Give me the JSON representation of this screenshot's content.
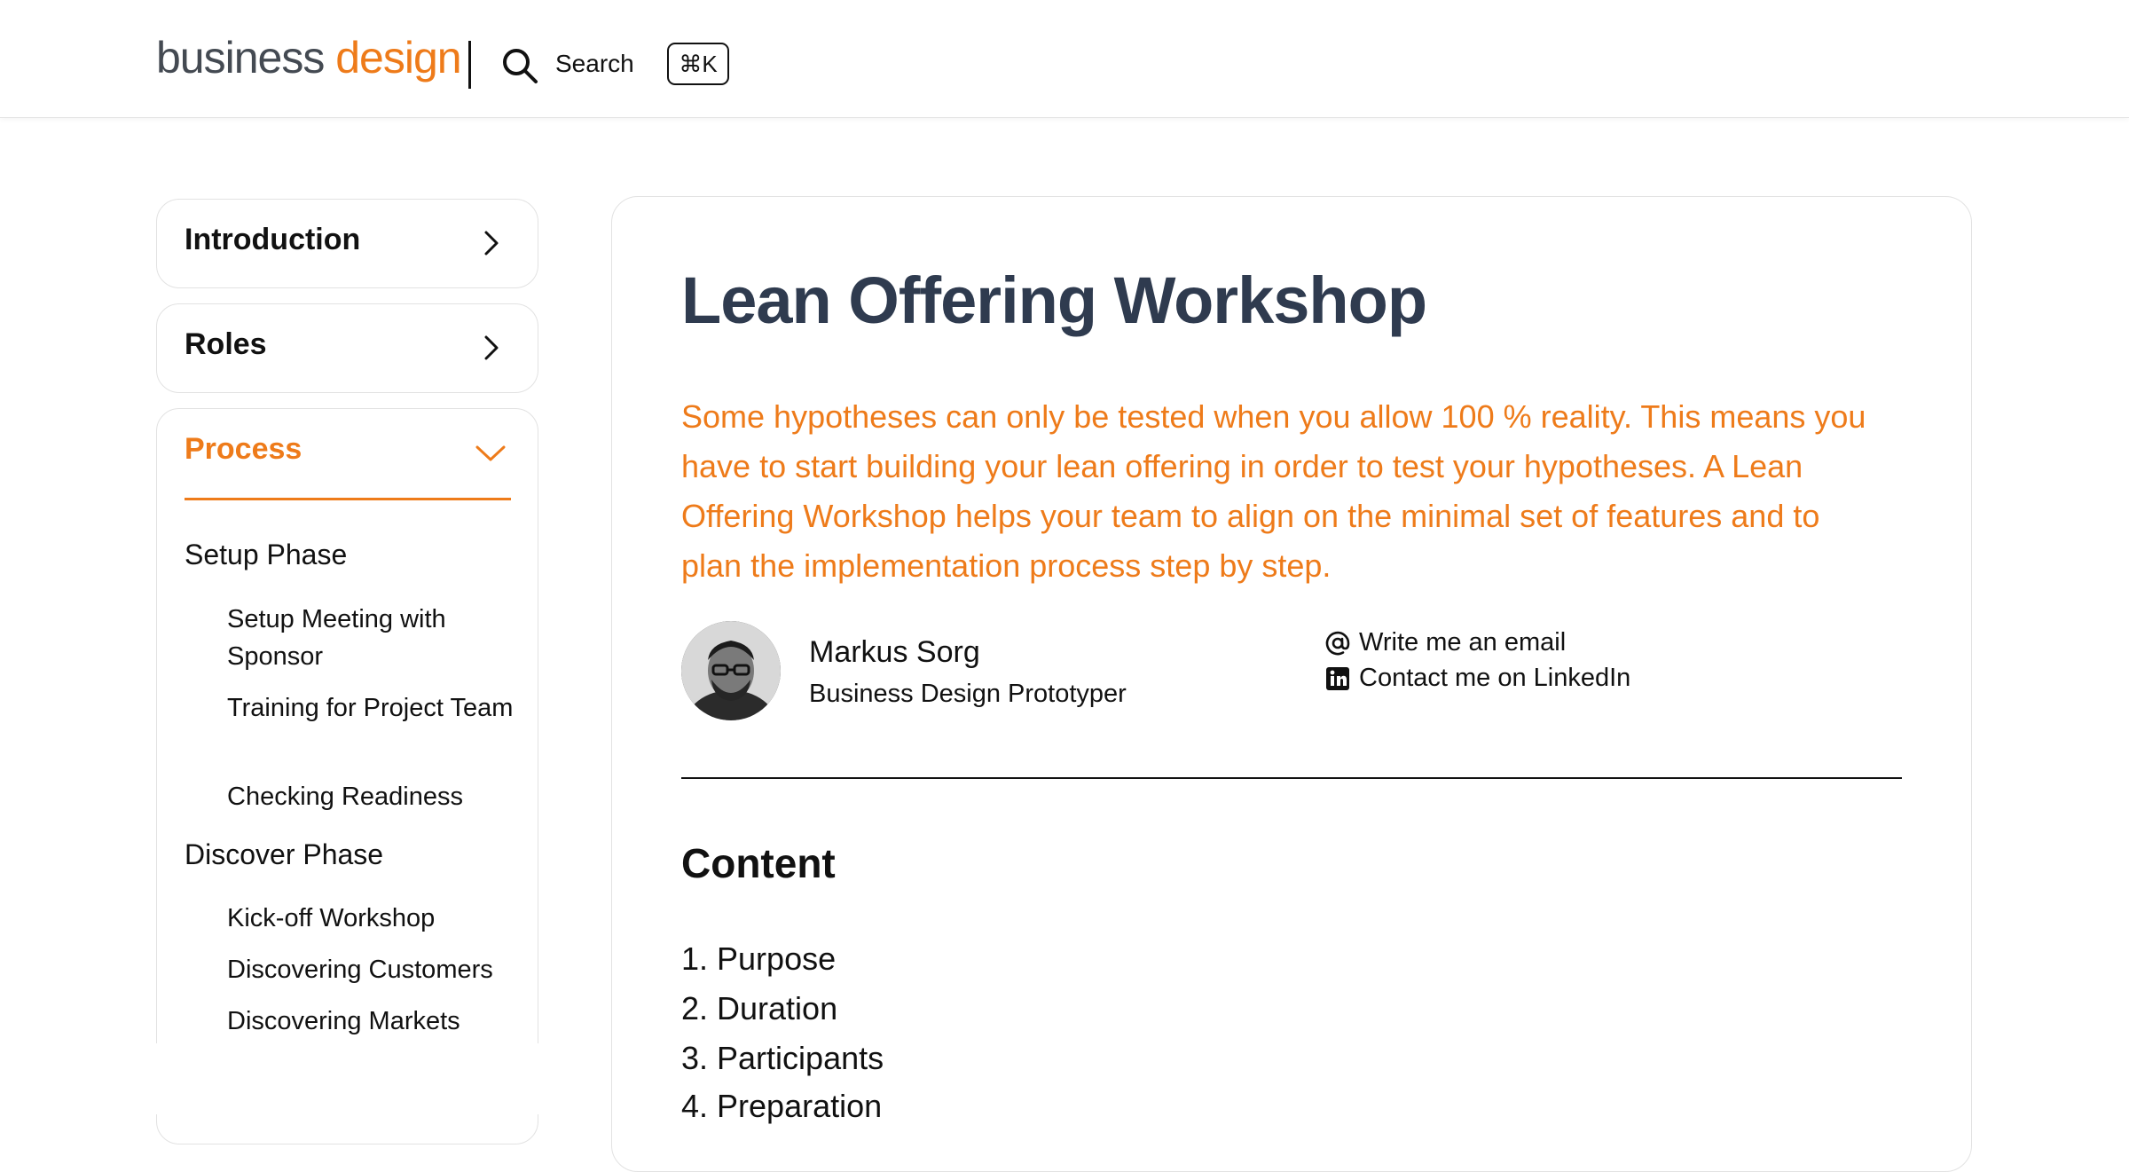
{
  "header": {
    "logo_word1": "business",
    "logo_word2": "design",
    "search_label": "Search",
    "search_shortcut": "⌘K"
  },
  "sidebar": {
    "introduction": "Introduction",
    "roles": "Roles",
    "process": "Process",
    "phases": [
      {
        "label": "Setup Phase",
        "items": [
          "Setup Meeting with Sponsor",
          "Training for Project Team",
          "Checking Readiness"
        ]
      },
      {
        "label": "Discover Phase",
        "items": [
          "Kick-off Workshop",
          "Discovering Customers",
          "Discovering Markets"
        ]
      }
    ]
  },
  "article": {
    "title": "Lean Offering Workshop",
    "lede": "Some hypotheses can only be tested when you allow 100 % reality. This means you have to start building your lean offering in order to test your hypotheses. A Lean Offering Workshop helps your team to align on the minimal set of features and to plan the implementation process step by step.",
    "author": {
      "name": "Markus Sorg",
      "role": "Business Design Prototyper",
      "email_link": "Write me an email",
      "linkedin_link": "Contact me on LinkedIn"
    },
    "content_heading": "Content",
    "toc": [
      "1. Purpose",
      "2. Duration",
      "3. Participants",
      "4. Preparation"
    ]
  },
  "colors": {
    "accent": "#ee7b1a",
    "title": "#2f3b4f",
    "text": "#111111",
    "border": "#e2e2e2"
  },
  "icons": [
    "search-icon",
    "chevron-right-icon",
    "chevron-down-icon",
    "at-sign-icon",
    "linkedin-icon"
  ]
}
